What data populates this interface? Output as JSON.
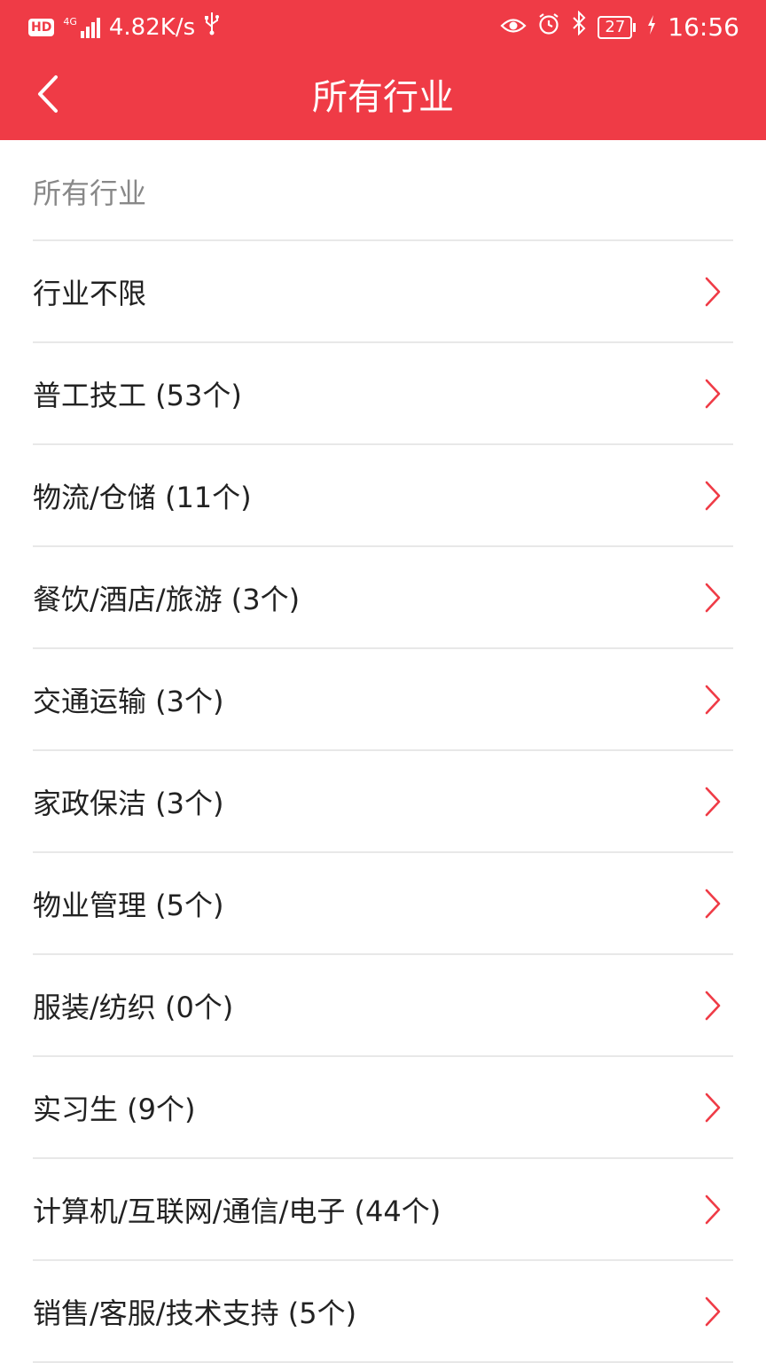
{
  "status_bar": {
    "hd": "HD",
    "network": "4G",
    "speed": "4.82K/s",
    "battery": "27",
    "time": "16:56"
  },
  "nav": {
    "title": "所有行业"
  },
  "section": {
    "title": "所有行业"
  },
  "items": [
    {
      "label": "行业不限"
    },
    {
      "label": "普工技工 (53个)"
    },
    {
      "label": "物流/仓储 (11个)"
    },
    {
      "label": "餐饮/酒店/旅游 (3个)"
    },
    {
      "label": "交通运输 (3个)"
    },
    {
      "label": "家政保洁 (3个)"
    },
    {
      "label": "物业管理 (5个)"
    },
    {
      "label": "服装/纺织 (0个)"
    },
    {
      "label": "实习生 (9个)"
    },
    {
      "label": "计算机/互联网/通信/电子 (44个)"
    },
    {
      "label": "销售/客服/技术支持 (5个)"
    }
  ],
  "colors": {
    "header": "#ef3b46",
    "chevron": "#ef3b46",
    "divider": "#e8e8e8",
    "section_text": "#888888",
    "item_text": "#222222"
  },
  "icons": {
    "back": "chevron-left-icon",
    "row": "chevron-right-icon"
  }
}
